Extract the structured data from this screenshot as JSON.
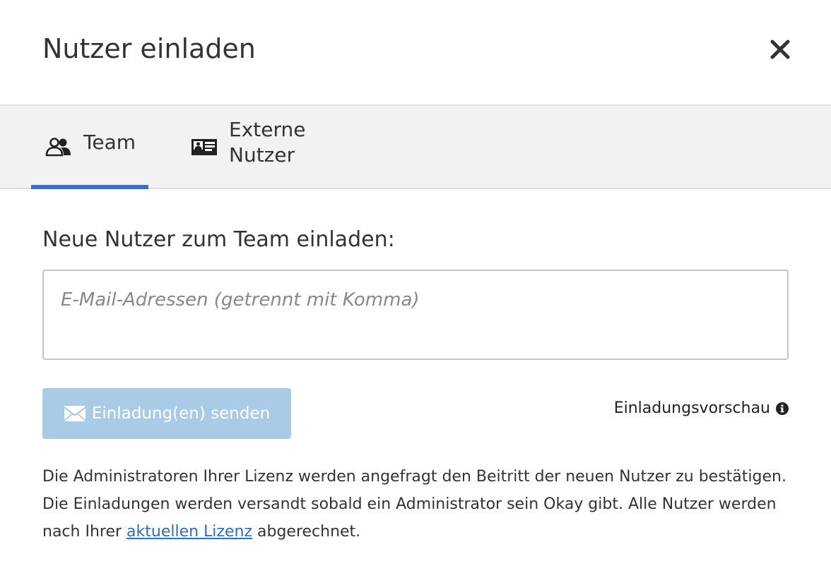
{
  "dialog": {
    "title": "Nutzer einladen",
    "close_icon": "close-icon"
  },
  "tabs": [
    {
      "label": "Team",
      "icon": "users-icon",
      "active": true
    },
    {
      "label": "Externe Nutzer",
      "icon": "id-card-icon",
      "active": false
    }
  ],
  "invite": {
    "heading": "Neue Nutzer zum Team einladen:",
    "email_placeholder": "E-Mail-Adressen (getrennt mit Komma)",
    "email_value": "",
    "send_label": "Einladung(en) senden",
    "send_icon": "envelope-icon",
    "preview_label": "Einladungsvorschau",
    "preview_icon": "info-icon"
  },
  "info": {
    "text_before": "Die Administratoren Ihrer Lizenz werden angefragt den Beitritt der neuen Nutzer zu bestätigen. Die Einladungen werden versandt sobald ein Administrator sein Okay gibt. Alle Nutzer werden nach Ihrer ",
    "link_text": "aktuellen Lizenz",
    "text_after": " abgerechnet."
  },
  "colors": {
    "accent": "#3b6fcf",
    "send_button_disabled": "#aacbe5",
    "link": "#2d6fbb",
    "tabbar_bg": "#f2f2f2"
  }
}
